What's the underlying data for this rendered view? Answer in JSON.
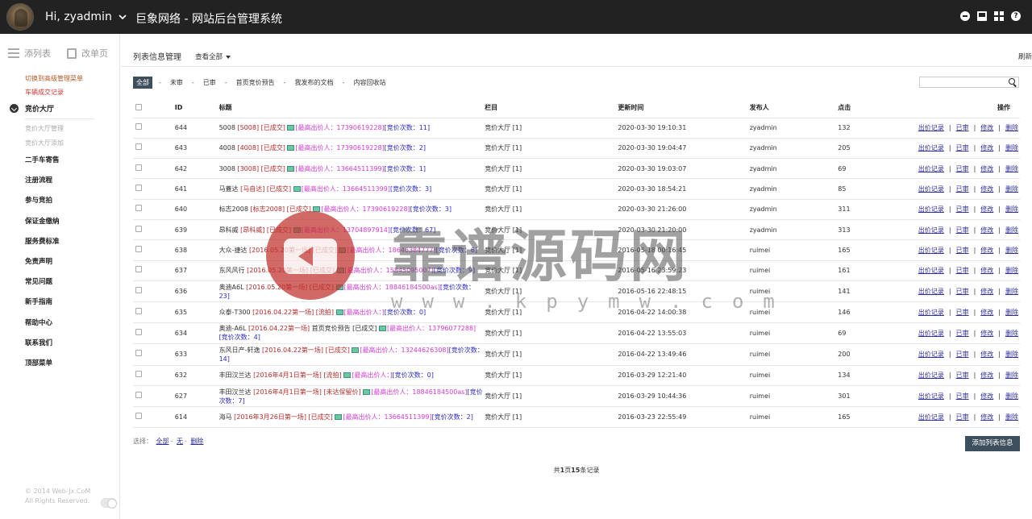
{
  "header": {
    "greeting": "Hi, zyadmin",
    "title": "巨象网络 - 网站后台管理系统",
    "icons": [
      "minus-circle-icon",
      "monitor-icon",
      "grid-icon",
      "help-icon"
    ]
  },
  "sidebar": {
    "tabs": [
      {
        "label": "添列表",
        "icon": "list-icon"
      },
      {
        "label": "改单页",
        "icon": "page-icon"
      }
    ],
    "links": [
      "切换到高级管理菜单",
      "车辆成交记录"
    ],
    "group": {
      "title": "竞价大厅",
      "subs": [
        "竞价大厅管理",
        "竞价大厅添加"
      ]
    },
    "menu": [
      "二手车寄售",
      "注册流程",
      "参与竞拍",
      "保证金缴纳",
      "服务费标准",
      "免责声明",
      "常见问题",
      "新手指南",
      "帮助中心",
      "联系我们",
      "顶部菜单"
    ],
    "copyright": [
      "© 2014 Web-Jx.CoM",
      "All Rights Reserved."
    ]
  },
  "main": {
    "title": "列表信息管理",
    "view_all": "查看全部",
    "refresh": "刷新",
    "filters": [
      "全部",
      "未审",
      "已审",
      "首页竞价预告",
      "我发布的文档",
      "内容回收站"
    ],
    "columns": {
      "id": "ID",
      "title": "标题",
      "column": "栏目",
      "updated": "更新时间",
      "publisher": "发布人",
      "clicks": "点击",
      "ops": "操作"
    },
    "ops": [
      "出价记录",
      "已审",
      "修改",
      "删除"
    ],
    "rows": [
      {
        "id": "644",
        "name": "5008",
        "code": "[5008]",
        "status": "[已成交]",
        "high": "[最高出价人：17390619228]",
        "count": "[竞价次数：11]",
        "column": "竞价大厅 [1]",
        "time": "2020-03-30 19:10:31",
        "pub": "zyadmin",
        "clicks": "132"
      },
      {
        "id": "643",
        "name": "4008",
        "code": "[4008]",
        "status": "[已成交]",
        "high": "[最高出价人：17390619228]",
        "count": "[竞价次数：2]",
        "column": "竞价大厅 [1]",
        "time": "2020-03-30 19:04:47",
        "pub": "zyadmin",
        "clicks": "205"
      },
      {
        "id": "642",
        "name": "3008",
        "code": "[3008]",
        "status": "[已成交]",
        "high": "[最高出价人：13664511399]",
        "count": "[竞价次数：1]",
        "column": "竞价大厅 [1]",
        "time": "2020-03-30 19:03:07",
        "pub": "zyadmin",
        "clicks": "69"
      },
      {
        "id": "641",
        "name": "马蓋达",
        "code": "[马自达]",
        "status": "[已成交]",
        "high": "[最高出价人：13664511399]",
        "count": "[竞价次数：3]",
        "column": "竞价大厅 [1]",
        "time": "2020-03-30 18:54:21",
        "pub": "zyadmin",
        "clicks": "85"
      },
      {
        "id": "640",
        "name": "标志2008",
        "code": "[标志2008]",
        "status": "[已成交]",
        "high": "[最高出价人：17390619228]",
        "count": "[竞价次数：3]",
        "column": "竞价大厅 [1]",
        "time": "2020-03-30 21:26:00",
        "pub": "zyadmin",
        "clicks": "311"
      },
      {
        "id": "639",
        "name": "昂科威",
        "code": "[昂科威]",
        "status": "[已成交]",
        "high": "[最高出价人：13704897914]",
        "count": "[竞价次数：67]",
        "column": "竞价大厅 [1]",
        "time": "2020-03-30 21:20:00",
        "pub": "zyadmin",
        "clicks": "313"
      },
      {
        "id": "638",
        "name": "大众-捷达",
        "code": "[2016.05.20第一场]",
        "status": "[已成交]",
        "high": "[最高出价人：18646384777]",
        "count": "[竞价次数：6]",
        "column": "竞价大厅 [1]",
        "time": "2016-05-18 00:16:45",
        "pub": "ruimei",
        "clicks": "165"
      },
      {
        "id": "637",
        "name": "东风风行",
        "code": "[2016.05.20第一场]",
        "status": "[已成交]",
        "high": "[最高出价人：15845095007]",
        "count": "[竞价次数：9]",
        "column": "竞价大厅 [1]",
        "time": "2016-05-16 23:59:23",
        "pub": "ruimei",
        "clicks": "161"
      },
      {
        "id": "636",
        "name": "奥迪A6L",
        "code": "[2016.05.20第一场]",
        "status": "[已成交]",
        "high": "[最高出价人：18846184500as]",
        "count": "[竞价次数：23]",
        "column": "竞价大厅 [1]",
        "time": "2016-05-16 22:48:15",
        "pub": "ruimei",
        "clicks": "141"
      },
      {
        "id": "635",
        "name": "众泰-T300",
        "code": "[2016.04.22第一场]",
        "status": "[流拍]",
        "high": "[最高出价人：]",
        "count": "[竞价次数：0]",
        "column": "竞价大厅 [1]",
        "time": "2016-04-22 14:00:38",
        "pub": "ruimei",
        "clicks": "146"
      },
      {
        "id": "634",
        "name": "奥迪-A6L",
        "code": "[2016.04.22第一场]",
        "status": "首页竞价预告 [已成交]",
        "high": "[最高出价人：13796077288]",
        "count": "[竞价次数：4]",
        "column": "竞价大厅 [1]",
        "time": "2016-04-22 13:55:03",
        "pub": "ruimei",
        "clicks": "69"
      },
      {
        "id": "633",
        "name": "东风日产-轩逸",
        "code": "[2016.04.22第一场]",
        "status": "[已成交]",
        "high": "[最高出价人：13244626308]",
        "count": "[竞价次数：14]",
        "column": "竞价大厅 [1]",
        "time": "2016-04-22 13:49:46",
        "pub": "ruimei",
        "clicks": "200"
      },
      {
        "id": "632",
        "name": "丰田汉兰达",
        "code": "[2016年4月1日第一场]",
        "status": "[流拍]",
        "high": "[最高出价人：]",
        "count": "[竞价次数：0]",
        "column": "竞价大厅 [1]",
        "time": "2016-03-29 12:21:40",
        "pub": "ruimei",
        "clicks": "134"
      },
      {
        "id": "627",
        "name": "丰田汉兰达",
        "code": "[2016年4月1日第一场]",
        "status": "[未达保留价]",
        "high": "[最高出价人：18846184500as]",
        "count": "[竞价次数：7]",
        "column": "竞价大厅 [1]",
        "time": "2016-03-29 10:44:36",
        "pub": "ruimei",
        "clicks": "301"
      },
      {
        "id": "614",
        "name": "海马",
        "code": "[2016年3月26日第一场]",
        "status": "[已成交]",
        "high": "[最高出价人：13664511399]",
        "count": "[竞价次数：2]",
        "column": "竞价大厅 [1]",
        "time": "2016-03-23 22:55:49",
        "pub": "ruimei",
        "clicks": "165"
      }
    ],
    "select_label": "选择：",
    "select_links": [
      "全部",
      "无",
      "删除"
    ],
    "add_button": "添加列表信息",
    "pager": {
      "pre": "共",
      "pages": "1",
      "mid": "页",
      "records": "15",
      "post": "条记录"
    }
  },
  "watermark": {
    "text": "靠谱源码网",
    "url": "www.kpymw.com"
  }
}
